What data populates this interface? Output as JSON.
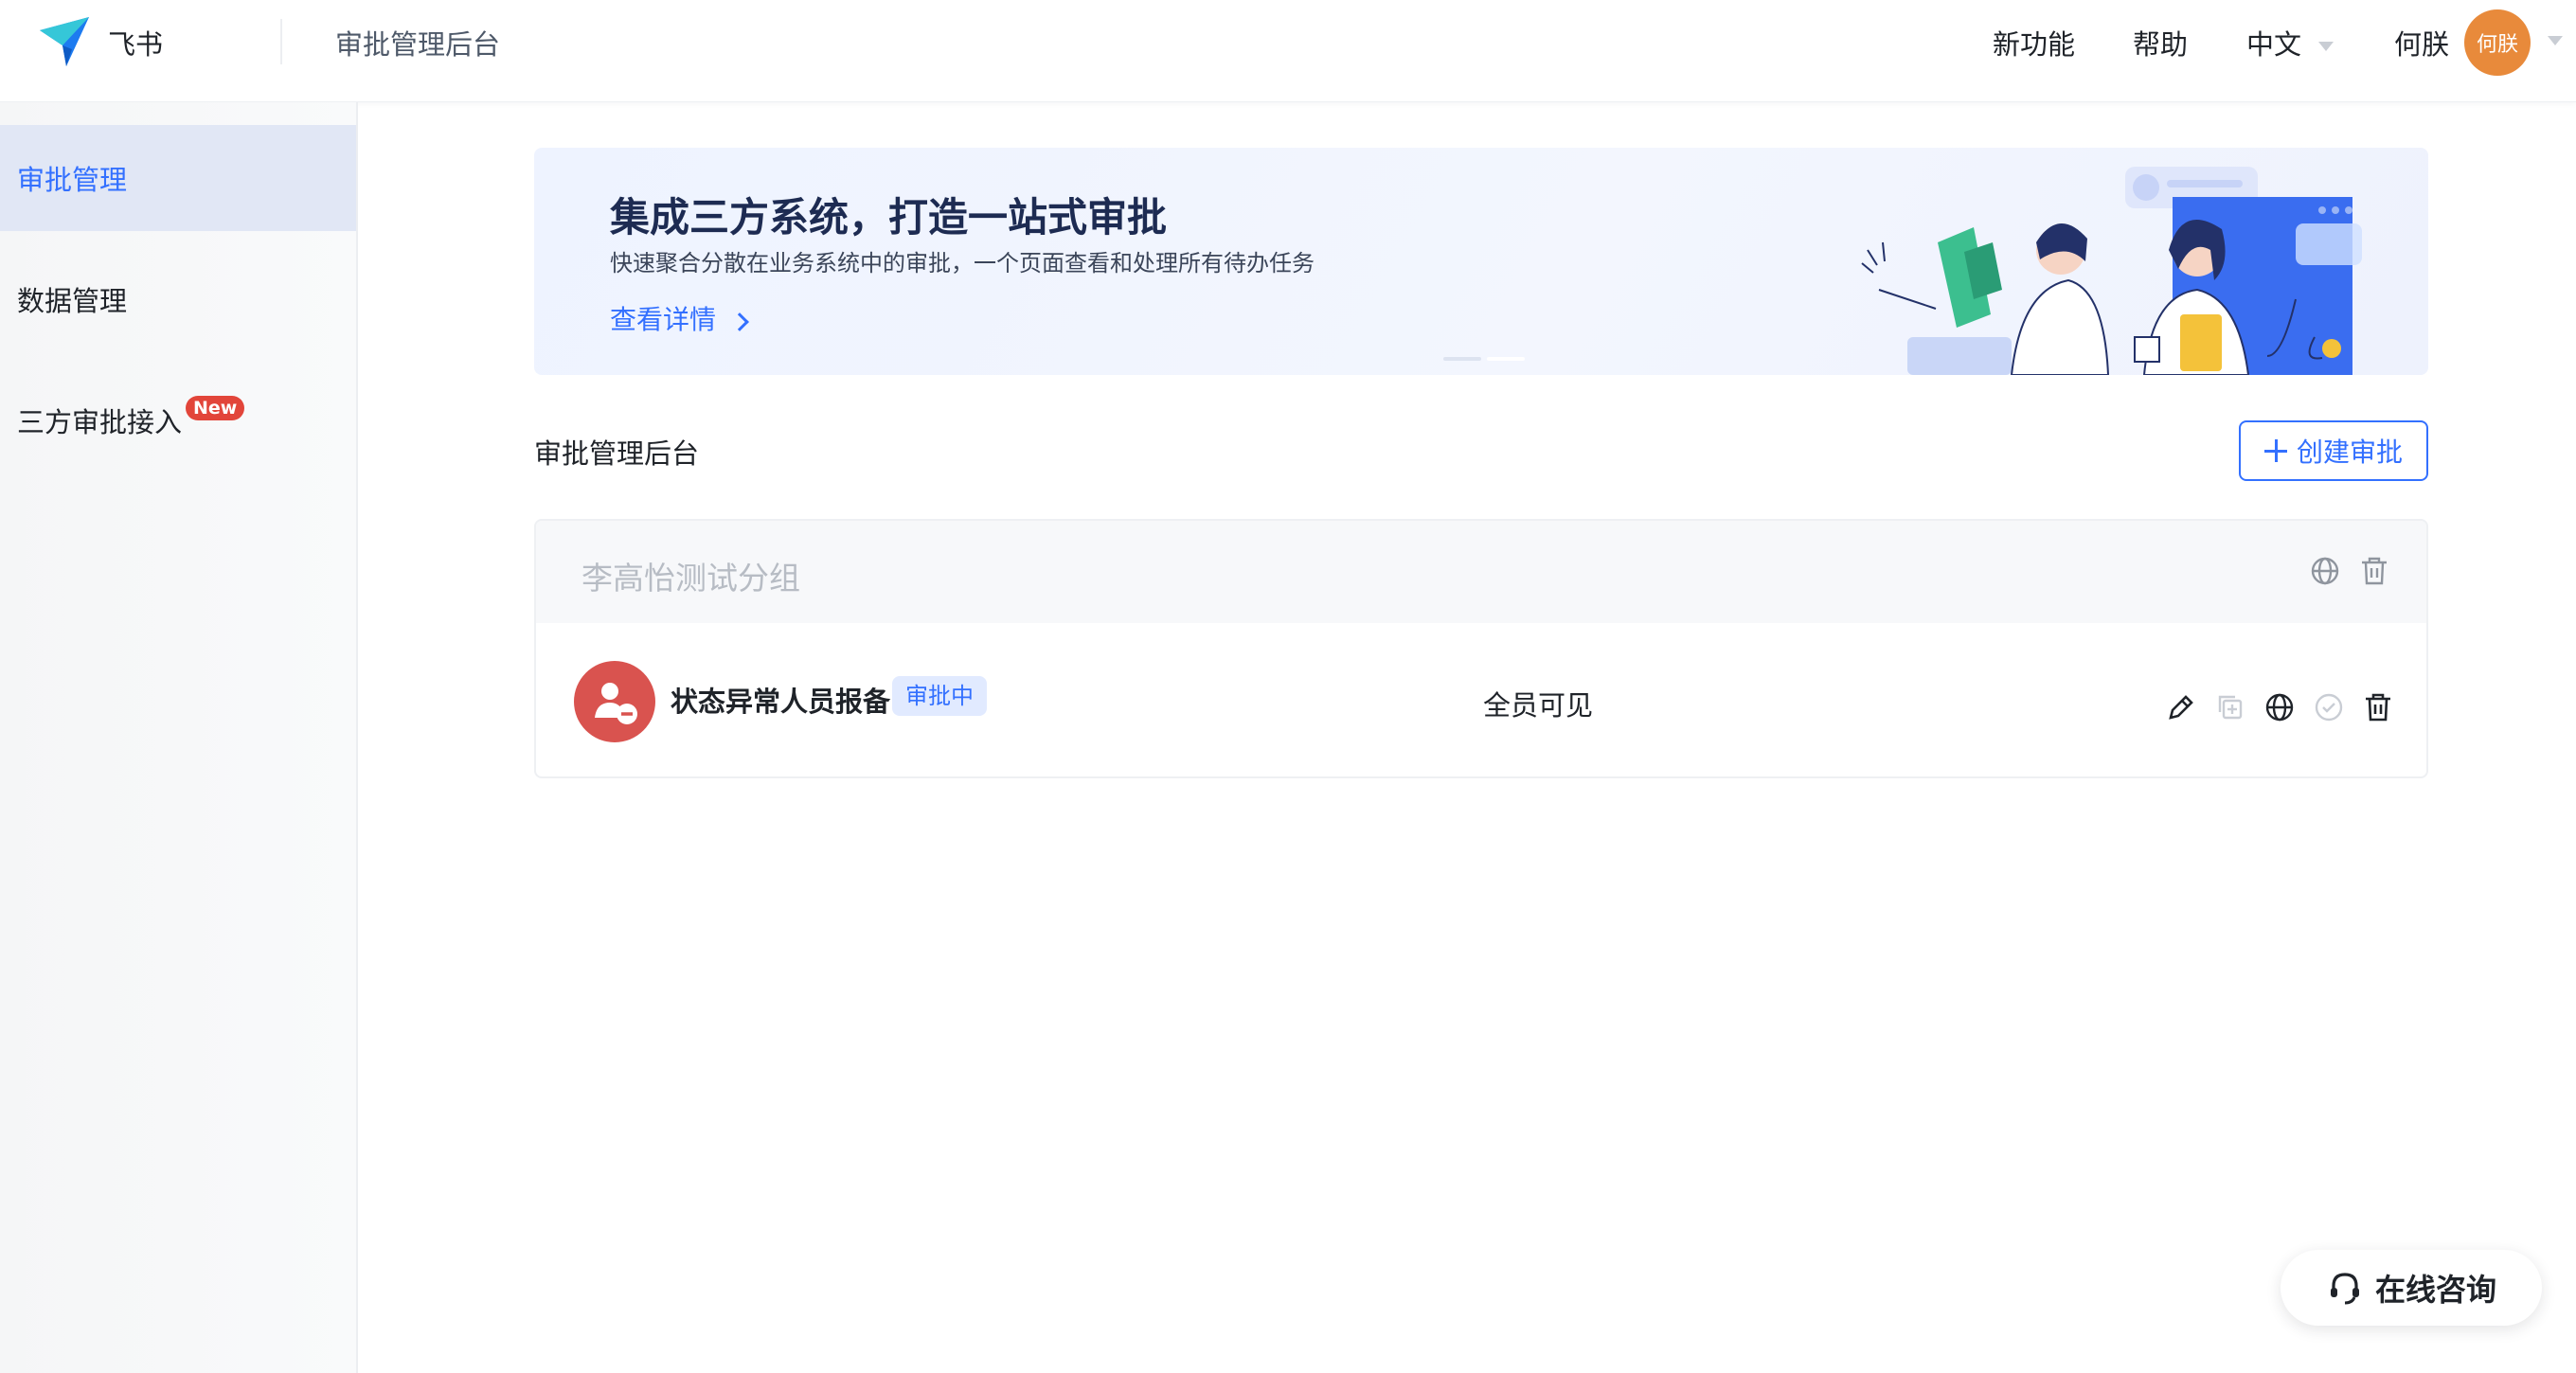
{
  "header": {
    "brand": "飞书",
    "console_title": "审批管理后台",
    "nav_new_features": "新功能",
    "nav_help": "帮助",
    "nav_language": "中文",
    "user_name": "何朕",
    "avatar_text": "何朕"
  },
  "sidebar": {
    "items": [
      {
        "label": "审批管理",
        "active": true
      },
      {
        "label": "数据管理",
        "active": false
      },
      {
        "label": "三方审批接入",
        "active": false,
        "badge": "New"
      }
    ]
  },
  "banner": {
    "title": "集成三方系统，打造一站式审批",
    "subtitle": "快速聚合分散在业务系统中的审批，一个页面查看和处理所有待办任务",
    "link": "查看详情"
  },
  "main": {
    "section_title": "审批管理后台",
    "create_button": "创建审批",
    "group": {
      "name": "李高怡测试分组",
      "rows": [
        {
          "name": "状态异常人员报备",
          "status": "审批中",
          "visibility": "全员可见"
        }
      ]
    }
  },
  "consult_button": "在线咨询",
  "colors": {
    "accent": "#3370ff",
    "avatar_orange": "#e88a3b",
    "row_avatar_red": "#d9534f",
    "badge_red": "#e2453a"
  }
}
